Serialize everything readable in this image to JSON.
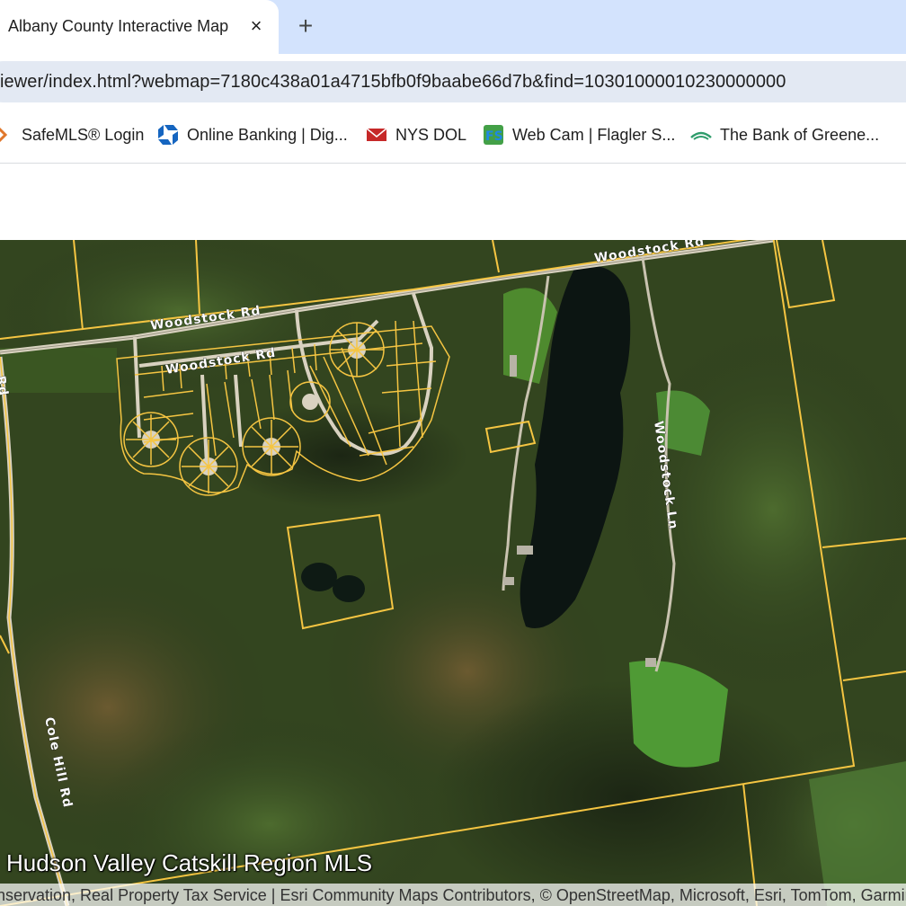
{
  "browser": {
    "tab_title": "Albany County Interactive Map",
    "tab_close_icon": "×",
    "new_tab_icon": "+",
    "url": "iewer/index.html?webmap=7180c438a01a4715bfb0f9baabe66d7b&find=10301000010230000000"
  },
  "bookmarks": [
    {
      "label": "SafeMLS® Login",
      "icon": "safemls-icon"
    },
    {
      "label": "Online Banking | Dig...",
      "icon": "chase-icon"
    },
    {
      "label": "NYS DOL",
      "icon": "nys-dol-icon"
    },
    {
      "label": "Web Cam | Flagler S...",
      "icon": "webcam-icon"
    },
    {
      "label": "The Bank of Greene...",
      "icon": "bank-icon"
    }
  ],
  "map": {
    "road_labels": {
      "woodstock_rd_main": "Woodstock Rd",
      "woodstock_rd_upper": "Woodstock Rd",
      "woodstock_rd_subdivision": "Woodstock Rd",
      "woodstock_ln": "Woodstock Ln",
      "cole_hill_rd": "Cole Hill Rd",
      "left_edge_rd": "Rd"
    },
    "watermark": "Hudson Valley Catskill Region MLS",
    "attribution": "nservation, Real Property Tax Service | Esri Community Maps Contributors, © OpenStreetMap, Microsoft, Esri, TomTom, Garmin"
  },
  "colors": {
    "parcel_line": "#f5c542",
    "road": "#d9d2c0",
    "water": "#0c1512",
    "tabstrip": "#d3e3fd"
  }
}
